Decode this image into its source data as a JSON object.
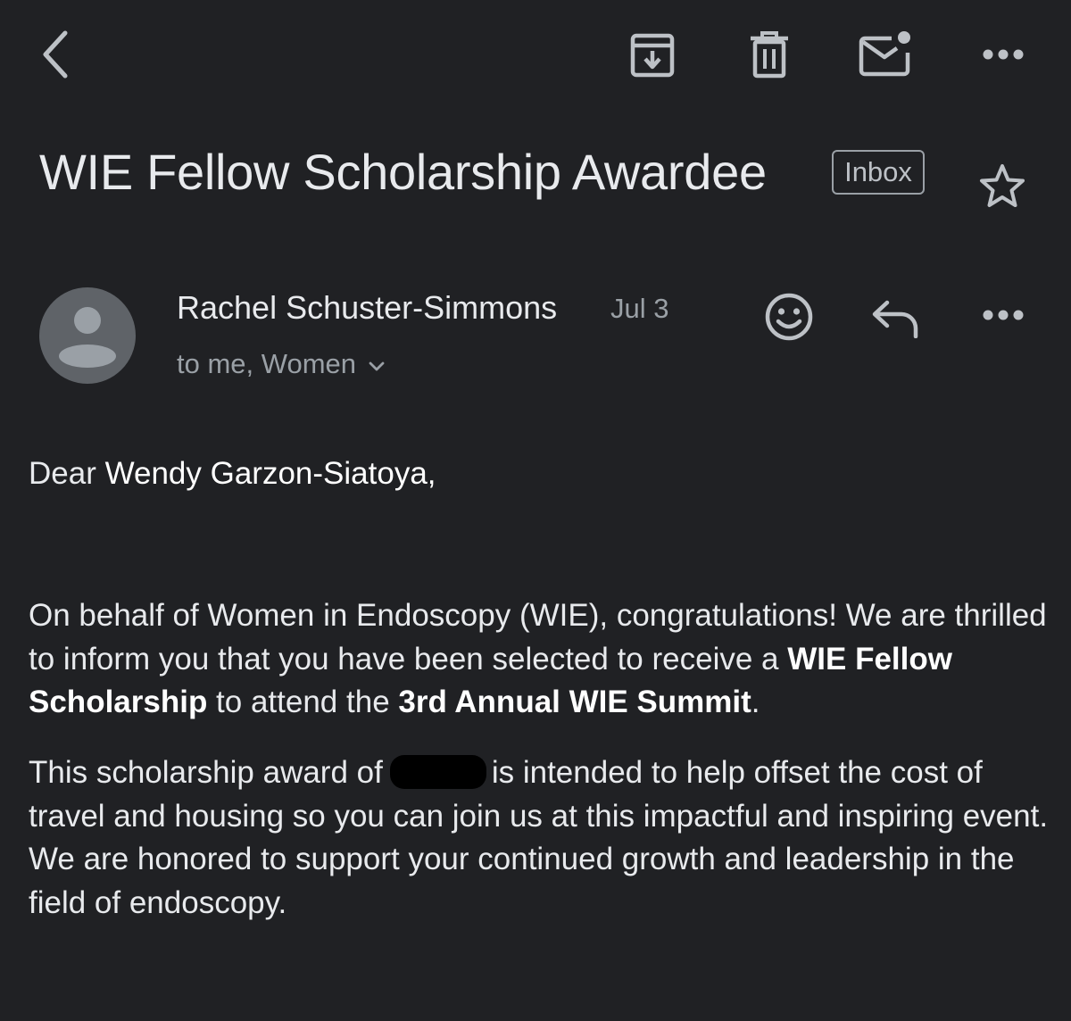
{
  "toolbar": {
    "back_icon": "chevron-left-icon",
    "archive_icon": "archive-icon",
    "delete_icon": "trash-icon",
    "mark_unread_icon": "mail-unread-icon",
    "more_icon": "more-horizontal-icon"
  },
  "email": {
    "subject": "WIE Fellow Scholarship Awardee",
    "label": "Inbox",
    "starred": false
  },
  "sender": {
    "name": "Rachel Schuster-Simmons",
    "date": "Jul 3",
    "recipients": "to me, Women"
  },
  "body": {
    "greeting_prefix": "Dear ",
    "greeting_name": "Wendy Garzon-Siatoya,",
    "p1_a": "On behalf of Women in Endoscopy (WIE), congratulations! We are thrilled to inform you that you have been selected to receive a ",
    "p1_b": "WIE Fellow Scholarship",
    "p1_c": " to attend the ",
    "p1_d": "3rd Annual WIE Summit",
    "p1_e": ".",
    "p2_a": "This scholarship award of",
    "p2_b": "is intended to help offset the cost of travel and housing so you can join us at this impactful and inspiring event. We are honored to support your continued growth and leadership in the field of endoscopy."
  },
  "colors": {
    "background": "#202124",
    "primary_text": "#e8eaed",
    "secondary_text": "#9aa0a6",
    "avatar_bg": "#5f6368",
    "icon": "#bdc1c6"
  }
}
